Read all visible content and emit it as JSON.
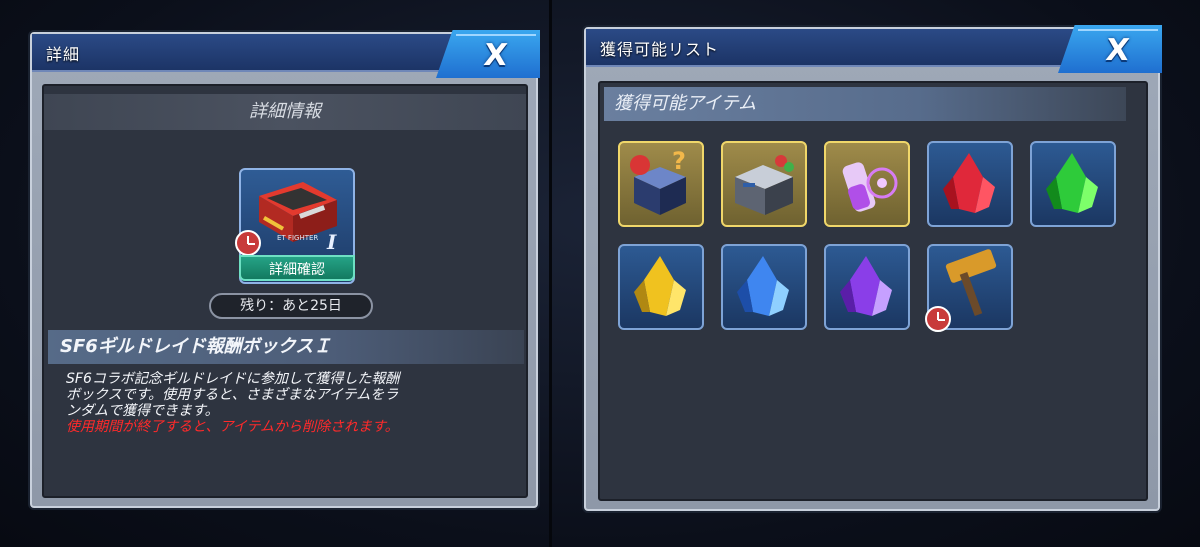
{
  "left_panel": {
    "title": "詳細",
    "close_label": "X",
    "section_title": "詳細情報",
    "item_label_text": "ET FIGHTER",
    "item_grade": "I",
    "detail_button": "詳細確認",
    "remaining": "残り：あと25日",
    "item_name": "SF6ギルドレイド報酬ボックスＩ",
    "description_lines": [
      "SF6コラボ記念ギルドレイドに参加して獲得した報酬",
      "ボックスです。使用すると、さまざまなアイテムをラ",
      "ンダムで獲得できます。"
    ],
    "warning": "使用期間が終了すると、アイテムから削除されます。"
  },
  "right_panel": {
    "title": "獲得可能リスト",
    "close_label": "X",
    "section_title": "獲得可能アイテム",
    "items": [
      {
        "icon": "mystery-box-icon",
        "frame": "gold"
      },
      {
        "icon": "treasure-crate-icon",
        "frame": "gold"
      },
      {
        "icon": "potion-bottle-icon",
        "frame": "gold"
      },
      {
        "icon": "red-crystal-icon",
        "frame": "blue"
      },
      {
        "icon": "green-crystal-icon",
        "frame": "blue"
      },
      {
        "icon": "yellow-crystal-icon",
        "frame": "blue"
      },
      {
        "icon": "blue-crystal-icon",
        "frame": "blue"
      },
      {
        "icon": "purple-crystal-icon",
        "frame": "blue"
      },
      {
        "icon": "hammer-icon",
        "frame": "blue",
        "timed": true
      }
    ]
  },
  "colors": {
    "title_bar": "#1c3466",
    "close_button": "#1f6fd0",
    "panel_bg": "#2e3440",
    "warning_text": "#ff2a2a",
    "detail_button": "#137a60"
  }
}
